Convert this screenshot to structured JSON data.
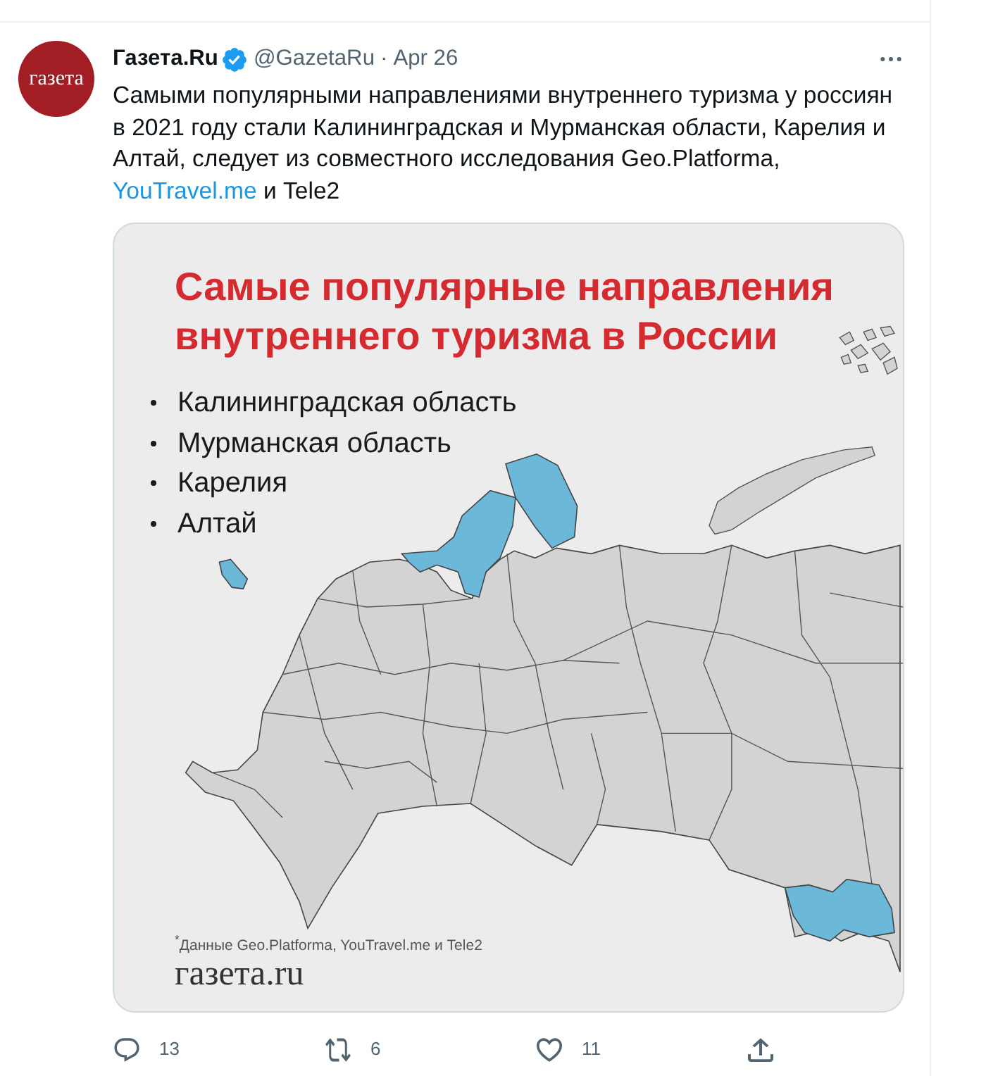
{
  "tweet": {
    "author": {
      "avatar_text": "газета",
      "name": "Газета.Ru",
      "verified": true,
      "handle": "@GazetaRu",
      "separator": "·",
      "date": "Apr 26"
    },
    "text_segments": [
      {
        "kind": "text",
        "text": "Самыми популярными направлениями внутреннего туризма у россиян в 2021 году стали Калининградская и Мурманская области, Карелия и Алтай, следует из совместного исследования Geo.Platforma, "
      },
      {
        "kind": "link",
        "text": "YouTravel.me"
      },
      {
        "kind": "text",
        "text": " и Tele2"
      }
    ],
    "infographic": {
      "title_lines": [
        "Самые популярные направления",
        "внутреннего туризма в России"
      ],
      "destinations": [
        "Калининградская область",
        "Мурманская область",
        "Карелия",
        "Алтай"
      ],
      "footnote": "$^{*}$Данные Geo.Platforma, YouTravel.me и Tele2",
      "logo": "газета.ru"
    },
    "actions": [
      {
        "kind": "reply",
        "count": "13"
      },
      {
        "kind": "retweet",
        "count": "6"
      },
      {
        "kind": "like",
        "count": "11"
      },
      {
        "kind": "share"
      }
    ]
  }
}
